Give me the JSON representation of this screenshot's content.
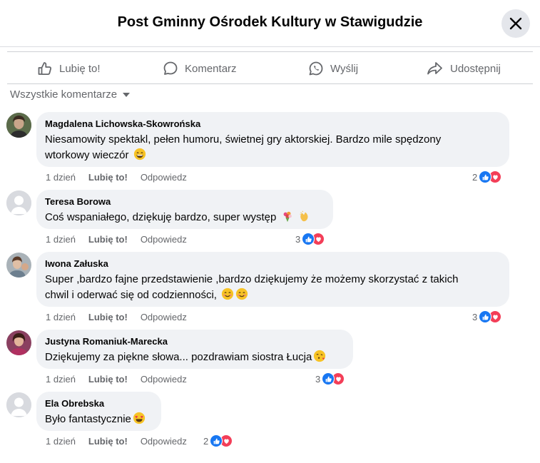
{
  "header": {
    "title": "Post Gminny Ośrodek Kultury w Stawigudzie"
  },
  "actions": {
    "like": "Lubię to!",
    "comment": "Komentarz",
    "send": "Wyślij",
    "share": "Udostępnij"
  },
  "filter": {
    "label": "Wszystkie komentarze"
  },
  "colors": {
    "like_blue": "#1877f2",
    "love_red": "#f33e58",
    "bubble_bg": "#f0f2f5",
    "muted_text": "#65676b"
  },
  "comments": [
    {
      "author": "Magdalena Lichowska-Skowrońska",
      "line1": "Niesamowity spektakl, pełen humoru, świetnej gry aktorskiej. Bardzo mile spędzony",
      "line2": "wtorkowy wieczór",
      "emojis": [
        "grinning-face"
      ],
      "time": "1 dzień",
      "like": "Lubię to!",
      "reply": "Odpowiedz",
      "reactions": "2"
    },
    {
      "author": "Teresa Borowa",
      "line1": "Coś wspaniałego, dziękuję bardzo, super występ",
      "emojis": [
        "bouquet",
        "clapping-hands"
      ],
      "time": "1 dzień",
      "like": "Lubię to!",
      "reply": "Odpowiedz",
      "reactions": "3"
    },
    {
      "author": "Iwona Załuska",
      "line1": "Super ,bardzo fajne przedstawienie ,bardzo dziękujemy że możemy skorzystać z takich",
      "line2": "chwil i oderwać się od codzienności,",
      "emojis": [
        "smiling-face",
        "smiling-face"
      ],
      "time": "1 dzień",
      "like": "Lubię to!",
      "reply": "Odpowiedz",
      "reactions": "3"
    },
    {
      "author": "Justyna Romaniuk-Marecka",
      "line1": "Dziękujemy za piękne słowa... pozdrawiam siostra Łucja",
      "emojis": [
        "face-blowing-kiss"
      ],
      "time": "1 dzień",
      "like": "Lubię to!",
      "reply": "Odpowiedz",
      "reactions": "3"
    },
    {
      "author": "Ela Obrebska",
      "line1": "Było fantastycznie",
      "emojis": [
        "heart-eyes-face"
      ],
      "time": "1 dzień",
      "like": "Lubię to!",
      "reply": "Odpowiedz",
      "reactions": "2"
    }
  ]
}
